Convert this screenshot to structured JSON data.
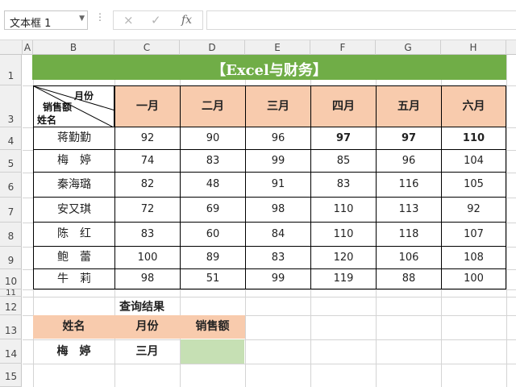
{
  "formula_bar": {
    "name_box": "文本框 1",
    "cancel_icon": "×",
    "enter_icon": "✓",
    "fx_label": "fx",
    "formula_value": ""
  },
  "columns": [
    "A",
    "B",
    "C",
    "D",
    "E",
    "F",
    "G",
    "H"
  ],
  "rows": [
    "1",
    "3",
    "4",
    "5",
    "6",
    "7",
    "8",
    "9",
    "10",
    "11",
    "12",
    "13",
    "14",
    "15"
  ],
  "title": "【Excel与财务】",
  "diagonal_header": {
    "top": "月份",
    "middle": "销售额",
    "bottom": "姓名"
  },
  "months": [
    "一月",
    "二月",
    "三月",
    "四月",
    "五月",
    "六月"
  ],
  "table": [
    {
      "name": "蒋勤勤",
      "values": [
        "92",
        "90",
        "96",
        "97",
        "97",
        "110"
      ]
    },
    {
      "name": "梅　婷",
      "values": [
        "74",
        "83",
        "99",
        "85",
        "96",
        "104"
      ]
    },
    {
      "name": "秦海璐",
      "values": [
        "82",
        "48",
        "91",
        "83",
        "116",
        "105"
      ]
    },
    {
      "name": "安又琪",
      "values": [
        "72",
        "69",
        "98",
        "110",
        "113",
        "92"
      ]
    },
    {
      "name": "陈　红",
      "values": [
        "83",
        "60",
        "84",
        "110",
        "118",
        "107"
      ]
    },
    {
      "name": "鲍　蕾",
      "values": [
        "100",
        "89",
        "83",
        "120",
        "106",
        "108"
      ]
    },
    {
      "name": "牛　莉",
      "values": [
        "98",
        "51",
        "99",
        "119",
        "88",
        "100"
      ]
    }
  ],
  "query": {
    "title": "查询结果",
    "headers": [
      "姓名",
      "月份",
      "销售额"
    ],
    "name": "梅　婷",
    "month": "三月",
    "result": ""
  },
  "colors": {
    "title_band": "#70ad47",
    "header_fill": "#f8cbad",
    "result_fill": "#c6e0b4"
  }
}
